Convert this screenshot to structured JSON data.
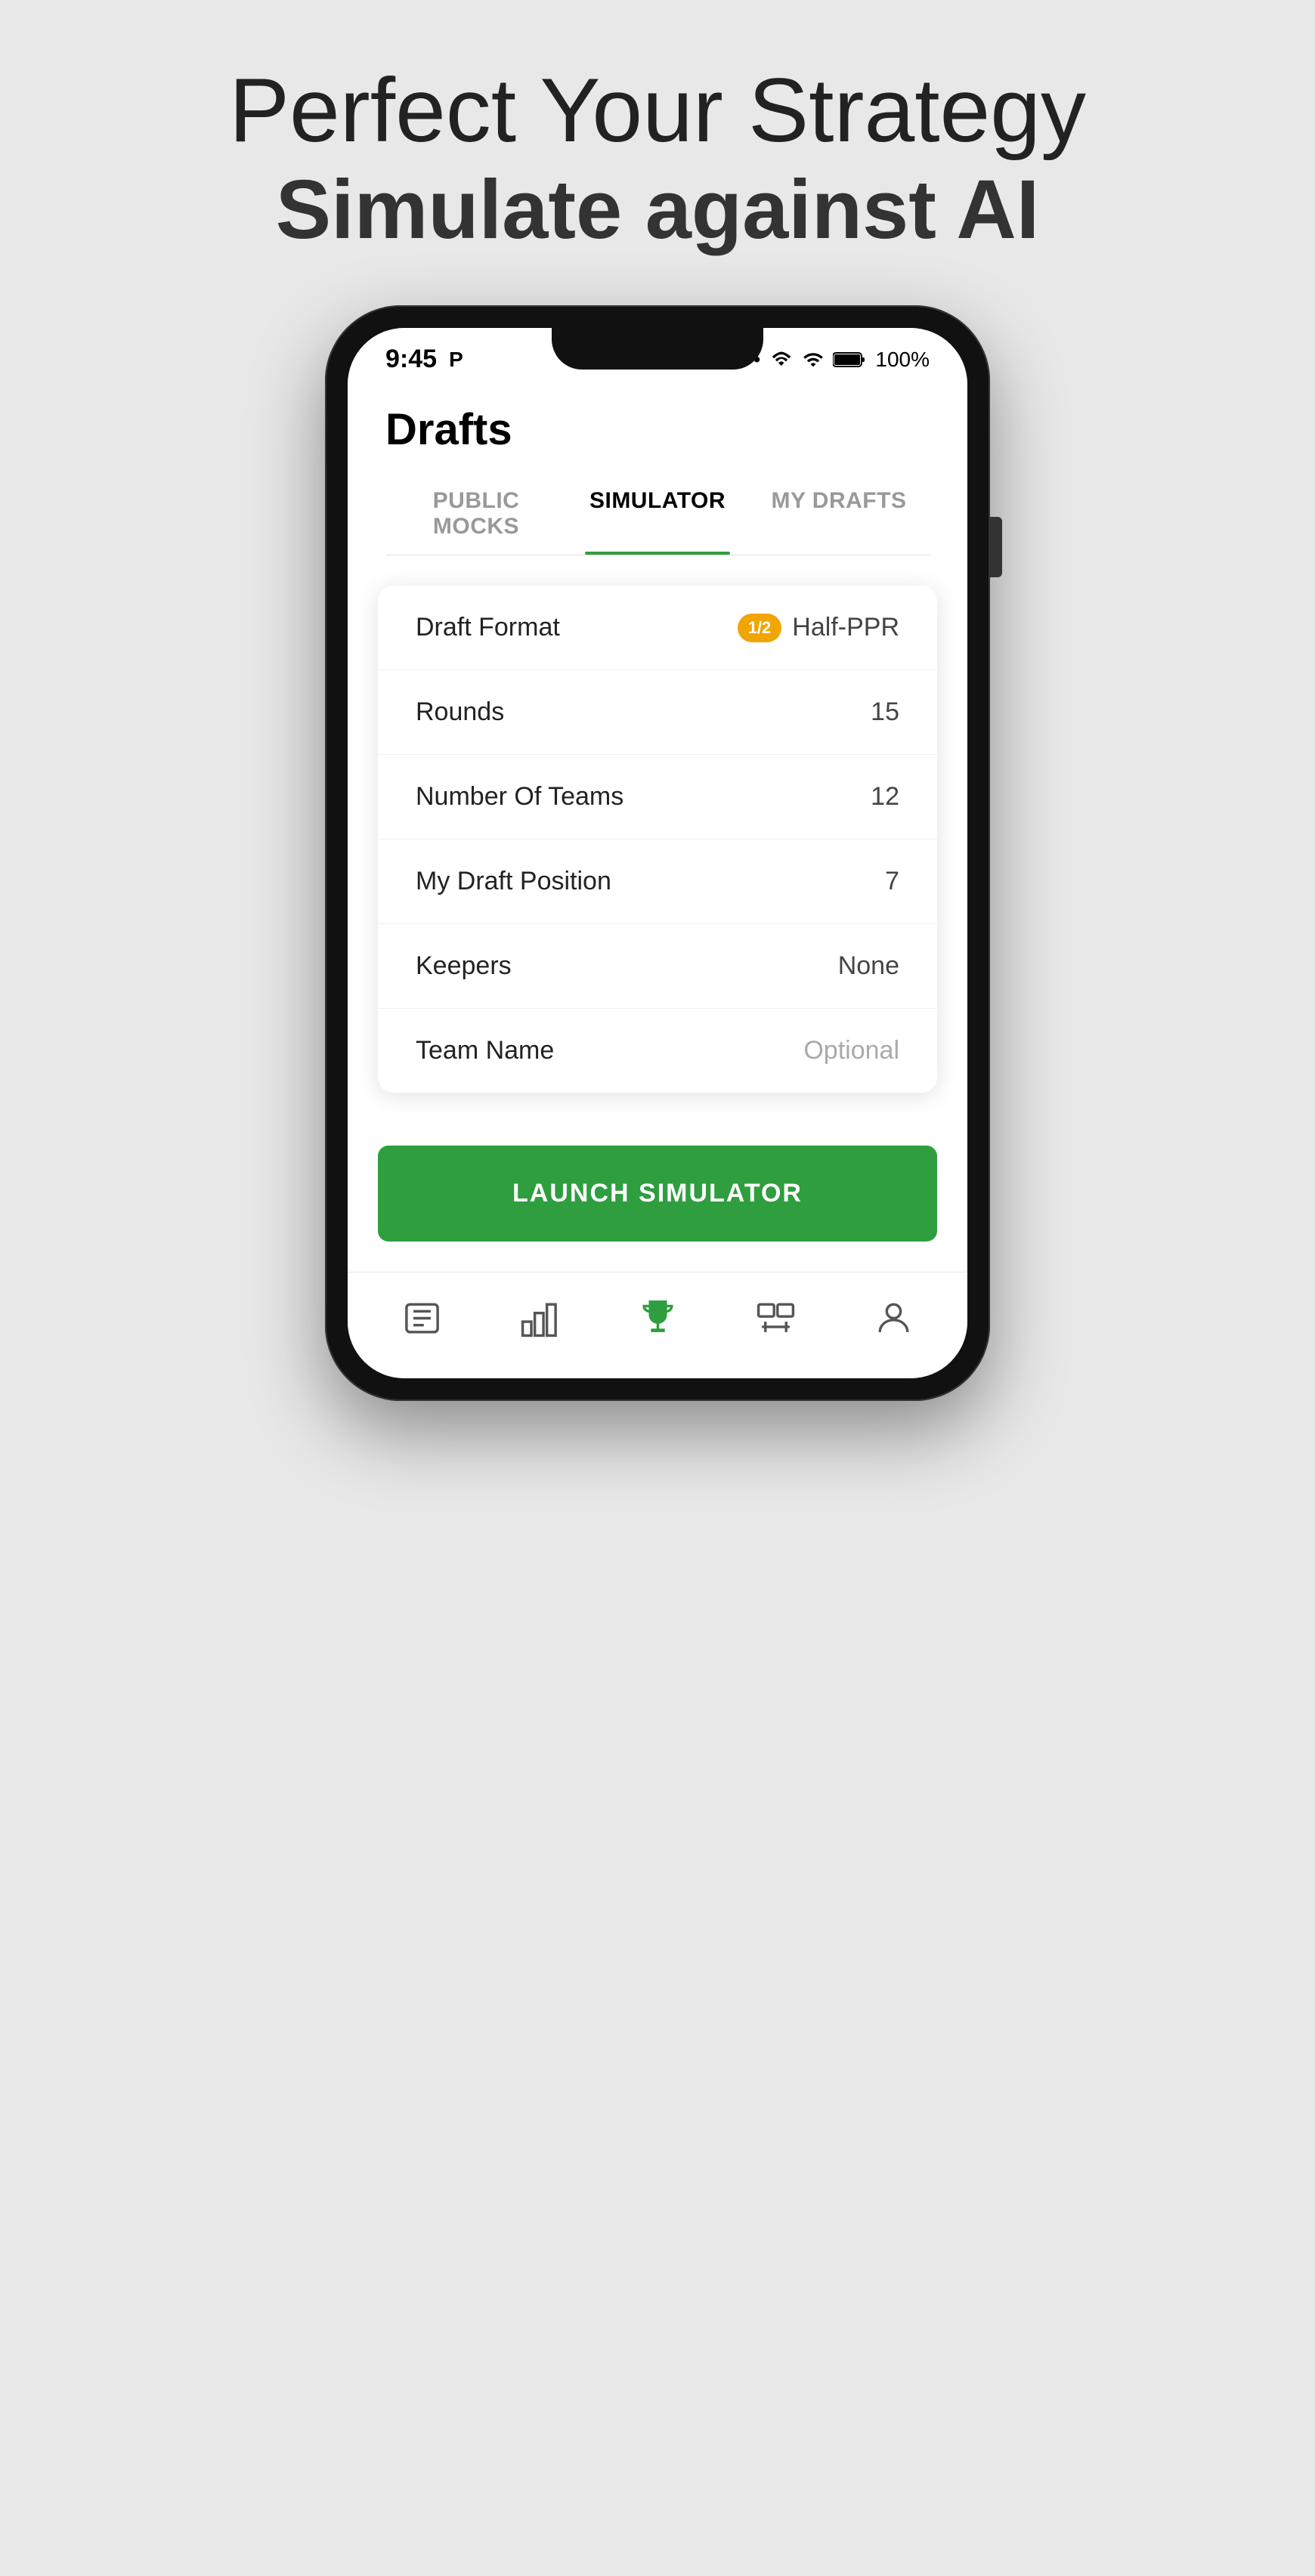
{
  "hero": {
    "title": "Perfect Your Strategy",
    "subtitle": "Simulate against AI"
  },
  "status_bar": {
    "time": "9:45",
    "app_icon": "P",
    "battery": "100%"
  },
  "app": {
    "header_title": "Drafts",
    "tabs": [
      {
        "id": "public-mocks",
        "label": "PUBLIC MOCKS",
        "active": false
      },
      {
        "id": "simulator",
        "label": "SIMULATOR",
        "active": true
      },
      {
        "id": "my-drafts",
        "label": "MY DRAFTS",
        "active": false
      }
    ]
  },
  "simulator": {
    "rows": [
      {
        "id": "draft-format",
        "label": "Draft Format",
        "value": "Half-PPR",
        "badge": "1/2",
        "type": "badge"
      },
      {
        "id": "rounds",
        "label": "Rounds",
        "value": "15",
        "type": "text"
      },
      {
        "id": "number-of-teams",
        "label": "Number Of Teams",
        "value": "12",
        "type": "text"
      },
      {
        "id": "my-draft-position",
        "label": "My Draft Position",
        "value": "7",
        "type": "text"
      },
      {
        "id": "keepers",
        "label": "Keepers",
        "value": "None",
        "type": "text"
      },
      {
        "id": "team-name",
        "label": "Team Name",
        "value": "Optional",
        "type": "optional"
      }
    ],
    "launch_button": "LAUNCH SIMULATOR"
  },
  "bottom_nav": [
    {
      "id": "news",
      "label": "News",
      "icon": "newspaper-icon"
    },
    {
      "id": "rankings",
      "label": "Rankings",
      "icon": "rankings-icon"
    },
    {
      "id": "drafts",
      "label": "Drafts",
      "icon": "trophy-icon",
      "active": true
    },
    {
      "id": "trade",
      "label": "Trade",
      "icon": "trade-icon"
    },
    {
      "id": "profile",
      "label": "Profile",
      "icon": "profile-icon"
    }
  ]
}
